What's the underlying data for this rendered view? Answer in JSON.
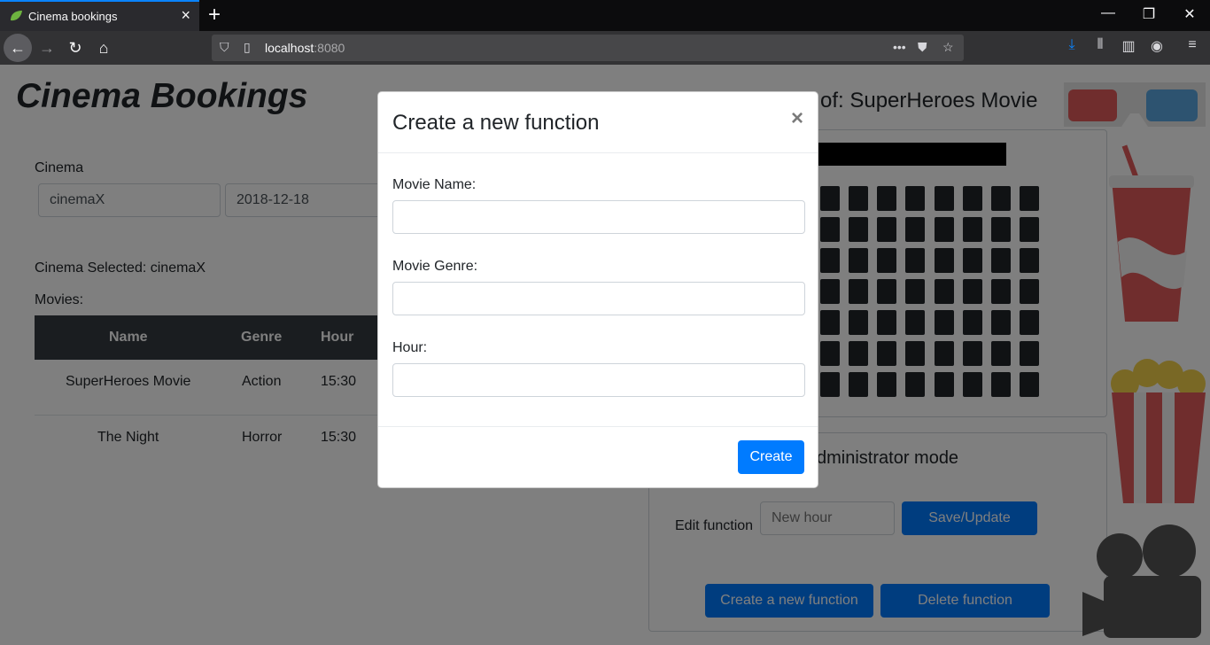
{
  "browser": {
    "tab_title": "Cinema bookings",
    "url_host": "localhost",
    "url_port": ":8080"
  },
  "app": {
    "title": "Cinema Bookings",
    "cinema_label": "Cinema",
    "cinema_value": "cinemaX",
    "date_value": "2018-12-18",
    "cinema_selected": "Cinema Selected: cinemaX",
    "movies_label": "Movies:",
    "table_headers": [
      "Name",
      "Genre",
      "Hour"
    ],
    "movies": [
      {
        "name": "SuperHeroes Movie",
        "genre": "Action",
        "hour": "15:30"
      },
      {
        "name": "The Night",
        "genre": "Horror",
        "hour": "15:30"
      }
    ],
    "availability_title": "of: SuperHeroes Movie",
    "admin_title": "dministrator mode",
    "edit_function_label": "Edit function",
    "new_hour_placeholder": "New hour",
    "save_update_label": "Save/Update",
    "create_new_function_label": "Create a new function",
    "delete_function_label": "Delete function"
  },
  "modal": {
    "title": "Create a new function",
    "close_glyph": "×",
    "movie_name_label": "Movie Name:",
    "movie_genre_label": "Movie Genre:",
    "hour_label": "Hour:",
    "create_label": "Create"
  },
  "colors": {
    "primary": "#007bff",
    "table_header": "#343a40",
    "browser_accent": "#0a84ff"
  }
}
